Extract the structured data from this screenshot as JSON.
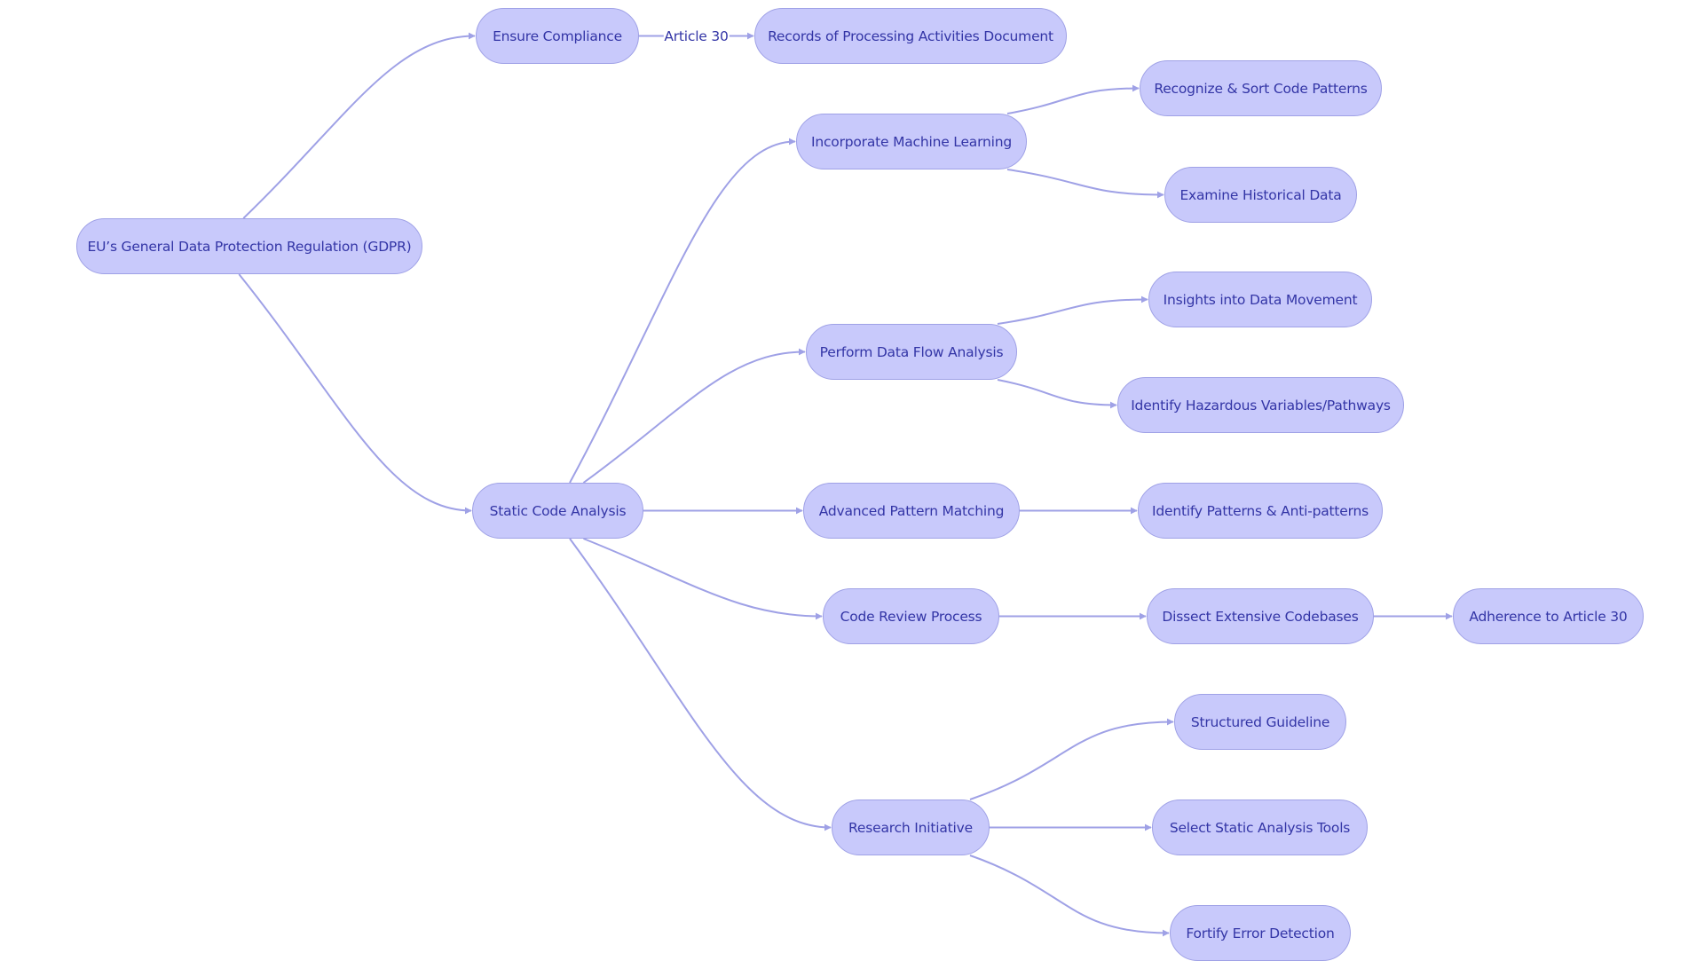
{
  "diagram": {
    "type": "flowchart",
    "direction": "left-to-right",
    "colors": {
      "node_fill": "#c8c9fb",
      "node_border": "#9fa1e6",
      "node_text": "#3335a6",
      "edge": "#9fa1e6"
    },
    "nodes": [
      {
        "id": "gdpr",
        "label": "EU’s General Data Protection Regulation (GDPR)"
      },
      {
        "id": "compliance",
        "label": "Ensure Compliance"
      },
      {
        "id": "records",
        "label": "Records of Processing Activities Document"
      },
      {
        "id": "sca",
        "label": "Static Code Analysis"
      },
      {
        "id": "ml",
        "label": "Incorporate Machine Learning"
      },
      {
        "id": "recognize",
        "label": "Recognize & Sort Code Patterns"
      },
      {
        "id": "historical",
        "label": "Examine Historical Data"
      },
      {
        "id": "dataflow",
        "label": "Perform Data Flow Analysis"
      },
      {
        "id": "insights",
        "label": "Insights into Data Movement"
      },
      {
        "id": "hazardous",
        "label": "Identify Hazardous Variables/Pathways"
      },
      {
        "id": "pattern",
        "label": "Advanced Pattern Matching"
      },
      {
        "id": "antipatterns",
        "label": "Identify Patterns & Anti-patterns"
      },
      {
        "id": "review",
        "label": "Code Review Process"
      },
      {
        "id": "dissect",
        "label": "Dissect Extensive Codebases"
      },
      {
        "id": "adherence",
        "label": "Adherence to Article 30"
      },
      {
        "id": "research",
        "label": "Research Initiative"
      },
      {
        "id": "guideline",
        "label": "Structured Guideline"
      },
      {
        "id": "tools",
        "label": "Select Static Analysis Tools"
      },
      {
        "id": "fortify",
        "label": "Fortify Error Detection"
      }
    ],
    "edges": [
      {
        "from": "gdpr",
        "to": "compliance",
        "label": ""
      },
      {
        "from": "gdpr",
        "to": "sca",
        "label": ""
      },
      {
        "from": "compliance",
        "to": "records",
        "label": "Article 30"
      },
      {
        "from": "sca",
        "to": "ml",
        "label": ""
      },
      {
        "from": "sca",
        "to": "dataflow",
        "label": ""
      },
      {
        "from": "sca",
        "to": "pattern",
        "label": ""
      },
      {
        "from": "sca",
        "to": "review",
        "label": ""
      },
      {
        "from": "sca",
        "to": "research",
        "label": ""
      },
      {
        "from": "ml",
        "to": "recognize",
        "label": ""
      },
      {
        "from": "ml",
        "to": "historical",
        "label": ""
      },
      {
        "from": "dataflow",
        "to": "insights",
        "label": ""
      },
      {
        "from": "dataflow",
        "to": "hazardous",
        "label": ""
      },
      {
        "from": "pattern",
        "to": "antipatterns",
        "label": ""
      },
      {
        "from": "review",
        "to": "dissect",
        "label": ""
      },
      {
        "from": "dissect",
        "to": "adherence",
        "label": ""
      },
      {
        "from": "research",
        "to": "guideline",
        "label": ""
      },
      {
        "from": "research",
        "to": "tools",
        "label": ""
      },
      {
        "from": "research",
        "to": "fortify",
        "label": ""
      }
    ]
  }
}
